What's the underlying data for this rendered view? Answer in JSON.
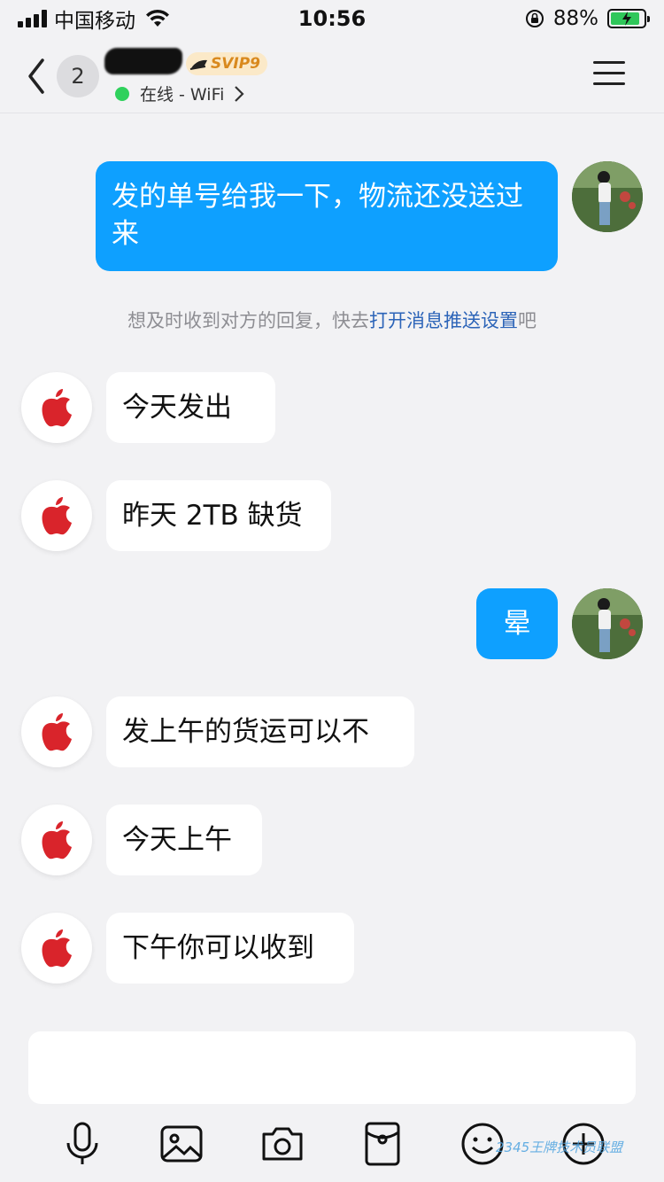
{
  "status_bar": {
    "carrier": "中国移动",
    "time": "10:56",
    "battery": "88%",
    "battery_level": 0.88
  },
  "header": {
    "unread_count": "2",
    "vip_label": "SVIP9",
    "presence": "在线 - WiFi"
  },
  "messages": [
    {
      "from": "me",
      "text": "发的单号给我一下，物流还没送过来"
    },
    {
      "from": "them",
      "text": "今天发出"
    },
    {
      "from": "them",
      "text": "昨天 2TB 缺货"
    },
    {
      "from": "me",
      "text": "晕"
    },
    {
      "from": "them",
      "text": "发上午的货运可以不"
    },
    {
      "from": "them",
      "text": "今天上午"
    },
    {
      "from": "them",
      "text": "下午你可以收到"
    }
  ],
  "system_tip": {
    "prefix": "想及时收到对方的回复，快去",
    "link": "打开消息推送设置",
    "suffix": "吧"
  },
  "input": {
    "placeholder": ""
  },
  "toolbar": {
    "icons": [
      "microphone-icon",
      "image-icon",
      "camera-icon",
      "red-packet-icon",
      "emoji-icon",
      "plus-icon"
    ]
  },
  "watermark": "2345王牌技术员联盟",
  "colors": {
    "accent": "#0ea0ff",
    "online": "#2fd15c",
    "link": "#2c64b8",
    "apple_red": "#d9242b"
  }
}
